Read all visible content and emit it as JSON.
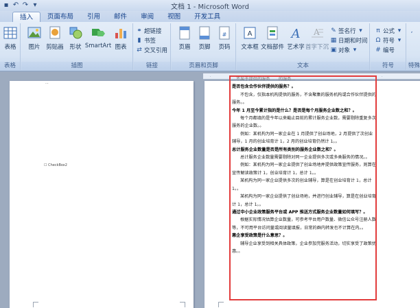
{
  "window": {
    "title": "文档 1 - Microsoft Word"
  },
  "quick_access": {
    "icons": [
      "save-icon",
      "undo-icon",
      "redo-icon",
      "customize-icon"
    ]
  },
  "tabs": [
    {
      "label": "插入",
      "active": true
    },
    {
      "label": "页面布局",
      "active": false
    },
    {
      "label": "引用",
      "active": false
    },
    {
      "label": "邮件",
      "active": false
    },
    {
      "label": "审阅",
      "active": false
    },
    {
      "label": "视图",
      "active": false
    },
    {
      "label": "开发工具",
      "active": false
    }
  ],
  "ribbon": {
    "groups": {
      "table": {
        "label": "表格",
        "buttons": [
          "表格"
        ]
      },
      "illustrations": {
        "label": "插图",
        "buttons": [
          "图片",
          "剪贴画",
          "形状",
          "SmartArt",
          "图表"
        ]
      },
      "links": {
        "label": "链接",
        "buttons": [
          "超链接",
          "书签",
          "交叉引用"
        ]
      },
      "header_footer": {
        "label": "页眉和页脚",
        "buttons": [
          "页眉",
          "页脚",
          "页码"
        ]
      },
      "text": {
        "label": "文本",
        "buttons": [
          "文本框",
          "文档部件",
          "艺术字",
          "首字下沉"
        ],
        "small_buttons": [
          "签名行",
          "日期和时间",
          "对象"
        ]
      },
      "symbols": {
        "label": "符号",
        "small_buttons": [
          "公式",
          "符号",
          "编号"
        ]
      },
      "special": {
        "label": "特殊"
      }
    }
  },
  "document": {
    "left_page": {
      "top_fragment": "...",
      "checkbox_label": "CheckBox2"
    },
    "paragraphs": [
      {
        "text": "...不属于提供的服务……的服务…",
        "style": "frag"
      },
      {
        "text": "是否包含合作伙伴提供的服务？。",
        "style": "head"
      },
      {
        "text": "不包含，仅指本机构提供的服务，不含聚集的服务机构或合作伙伴提供的服务。。",
        "style": "indent"
      },
      {
        "text": "今年 1 月至今累计指的是什么？是否是每个月服务企业数之和？。",
        "style": "head"
      },
      {
        "text": "每个月都填的是今年以来截止目前的累计服务企业数，需要剔除重复多次服务的企业数。。",
        "style": "indent"
      },
      {
        "text": "例如：某机构为同一家企业在 1 月提供了创业场地，2 月提供了次创业辅导，1 月的创业培育计 1，2 月的创业培育仍然计 1。。",
        "style": "indent"
      },
      {
        "text": "总计服务企业数量是否是所有类别的服务企业数之和？。",
        "style": "head"
      },
      {
        "text": "总计服务企业数量需要剔除对同一企业提供多次或多类服务的情况。。",
        "style": "indent"
      },
      {
        "text": "例如：某机构为同一家企业提供了创业场地并提供政策宣传服务，则算在宣传解读政策计 1，创业培育计 1，总计 1。。",
        "style": "indent"
      },
      {
        "text": "某机构为同一家企业提供多次的创业辅导，算是在创业培育计 1，总计 1。。",
        "style": "indent"
      },
      {
        "text": "某机构为同一家企业提供了创业场地，并进行创业辅导，算是在创业培育计 1，总计 1。。",
        "style": "indent"
      },
      {
        "text": "通过中小企业政策服务平台或 APP 推送方式服务企业数量如何填写？。",
        "style": "head"
      },
      {
        "text": "根据实际情况估算企业数量，可参考平台用户数量、微信公众号注册人数等，不可用平台访问量或阅读量填报，日常的群内转发也不计算在内。。",
        "style": "indent"
      },
      {
        "text": "惠企享受政策是什么意思？。",
        "style": "head"
      },
      {
        "text": "辅导企业享受到相关具体政策，企业参加完服务活动，切实享受了政策优惠。。",
        "style": "indent"
      }
    ]
  },
  "colors": {
    "highlight_border": "#e23b3b",
    "ribbon_text": "#1e395b",
    "tab_text": "#15428b"
  }
}
